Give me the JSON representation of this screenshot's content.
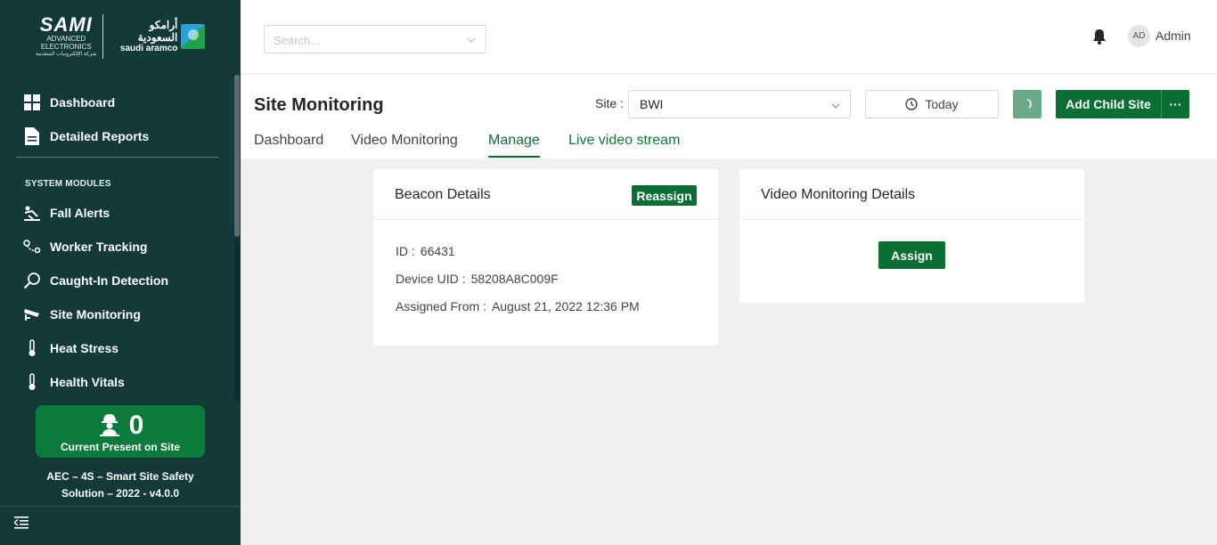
{
  "sidebar": {
    "brand": {
      "sami_name": "SAMI",
      "sami_sub1": "ADVANCED",
      "sami_sub2": "ELECTRONICS",
      "sami_arabic": "شركة الإلكترونيات المتقدمة",
      "aramco_arabic": "أرامكو السعودية",
      "aramco_english": "saudi aramco"
    },
    "main_items": [
      {
        "label": "Dashboard",
        "icon": "grid-icon"
      },
      {
        "label": "Detailed Reports",
        "icon": "document-icon"
      }
    ],
    "section_title": "SYSTEM MODULES",
    "module_items": [
      {
        "label": "Fall Alerts",
        "icon": "fall-icon"
      },
      {
        "label": "Worker Tracking",
        "icon": "route-icon"
      },
      {
        "label": "Caught-In Detection",
        "icon": "magnifier-icon"
      },
      {
        "label": "Site Monitoring",
        "icon": "cctv-camera-icon"
      },
      {
        "label": "Heat Stress",
        "icon": "thermometer-icon"
      },
      {
        "label": "Health Vitals",
        "icon": "thermometer-icon"
      }
    ],
    "present": {
      "count": "0",
      "label": "Current Present on Site"
    },
    "version_line1": "AEC – 4S – Smart Site Safety",
    "version_line2": "Solution – 2022 - v4.0.0"
  },
  "header": {
    "search_placeholder": "Search...",
    "user_initials": "AD",
    "user_name": "Admin"
  },
  "page": {
    "title": "Site Monitoring",
    "site_label": "Site :",
    "site_value": "BWI",
    "date_label": "Today",
    "add_child_label": "Add Child Site",
    "more_label": "···",
    "tabs": [
      {
        "label": "Dashboard"
      },
      {
        "label": "Video Monitoring"
      },
      {
        "label": "Manage"
      },
      {
        "label": "Live video stream"
      }
    ],
    "active_tab": "Manage"
  },
  "beacon_card": {
    "title": "Beacon Details",
    "action": "Reassign",
    "fields": [
      {
        "key": "ID :",
        "value": "66431"
      },
      {
        "key": "Device UID :",
        "value": "58208A8C009F"
      },
      {
        "key": "Assigned From :",
        "value": "August 21, 2022 12:36 PM"
      }
    ]
  },
  "video_card": {
    "title": "Video Monitoring Details",
    "action": "Assign"
  },
  "colors": {
    "sidebar_bg": "#133a38",
    "primary": "#0b6e35",
    "present_card": "#0b7a3a",
    "page_bg": "#f0f0f0"
  }
}
